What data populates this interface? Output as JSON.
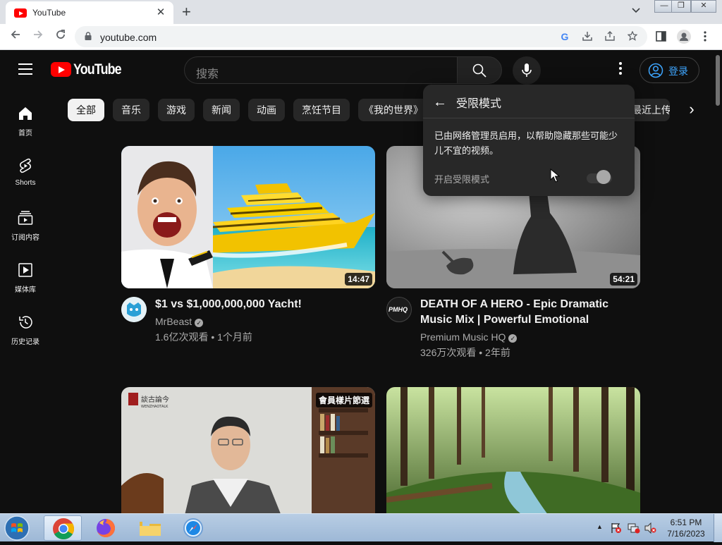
{
  "browser": {
    "tab_title": "YouTube",
    "tab_close": "✕",
    "new_tab": "+",
    "tab_menu": "⌄",
    "url": "youtube.com",
    "window_controls": [
      "—",
      "❐",
      "✕"
    ]
  },
  "youtube": {
    "logo_text": "YouTube",
    "search_placeholder": "搜索",
    "sign_in_label": "登录",
    "sidebar": [
      {
        "label": "首页",
        "icon": "home-icon"
      },
      {
        "label": "Shorts",
        "icon": "shorts-icon"
      },
      {
        "label": "订阅内容",
        "icon": "subscriptions-icon"
      },
      {
        "label": "媒体库",
        "icon": "library-icon"
      },
      {
        "label": "历史记录",
        "icon": "history-icon"
      }
    ],
    "chips": [
      "全部",
      "音乐",
      "游戏",
      "新闻",
      "动画",
      "烹饪节目",
      "《我的世界》",
      "最近上传"
    ],
    "chip_next": "›",
    "videos": [
      {
        "title": "$1 vs $1,000,000,000 Yacht!",
        "channel": "MrBeast",
        "meta": "1.6亿次观看 • 1个月前",
        "duration": "14:47"
      },
      {
        "title": "DEATH OF A HERO - Epic Dramatic Music Mix | Powerful Emotional Music…",
        "channel": "Premium Music HQ",
        "meta": "326万次观看 • 2年前",
        "duration": "54:21",
        "avatar_text": "PMHQ"
      },
      {
        "badge": "會員樣片節選",
        "logo_text": "談古論今",
        "logo_sub": "WENZHAOTALK"
      },
      {}
    ],
    "restricted_popup": {
      "back": "←",
      "title": "受限模式",
      "description": "已由网络管理员启用，以帮助隐藏那些可能少儿不宜的视频。",
      "toggle_label": "开启受限模式",
      "toggle_on": false
    }
  },
  "taskbar": {
    "time": "6:51 PM",
    "date": "7/16/2023"
  },
  "colors": {
    "yt_red": "#ff0000",
    "yt_bg": "#0f0f0f",
    "chip_bg": "#272727",
    "link_blue": "#3ea6ff"
  }
}
